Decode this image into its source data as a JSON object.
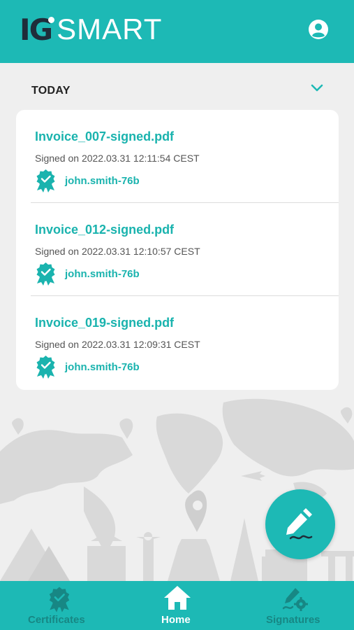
{
  "header": {
    "logo_ig": "IG",
    "logo_smart": "SMART",
    "profile_icon": "account-circle-icon"
  },
  "section": {
    "title": "TODAY",
    "toggle_icon": "chevron-down-icon"
  },
  "documents": [
    {
      "filename": "Invoice_007-signed.pdf",
      "signed": "Signed on 2022.03.31 12:11:54 CEST",
      "user": "john.smith-76b",
      "icon": "certificate-badge-icon"
    },
    {
      "filename": "Invoice_012-signed.pdf",
      "signed": "Signed on 2022.03.31 12:10:57 CEST",
      "user": "john.smith-76b",
      "icon": "certificate-badge-icon"
    },
    {
      "filename": "Invoice_019-signed.pdf",
      "signed": "Signed on 2022.03.31 12:09:31 CEST",
      "user": "john.smith-76b",
      "icon": "certificate-badge-icon"
    }
  ],
  "fab": {
    "icon": "pencil-sign-icon"
  },
  "nav": {
    "certificates": {
      "label": "Certificates",
      "icon": "certificate-badge-icon"
    },
    "home": {
      "label": "Home",
      "icon": "home-icon",
      "active": true
    },
    "signatures": {
      "label": "Signatures",
      "icon": "signature-gear-icon"
    }
  },
  "colors": {
    "brand": "#1db9b5",
    "link": "#1ab3ae",
    "nav_inactive": "#178784",
    "background": "#efefef"
  }
}
